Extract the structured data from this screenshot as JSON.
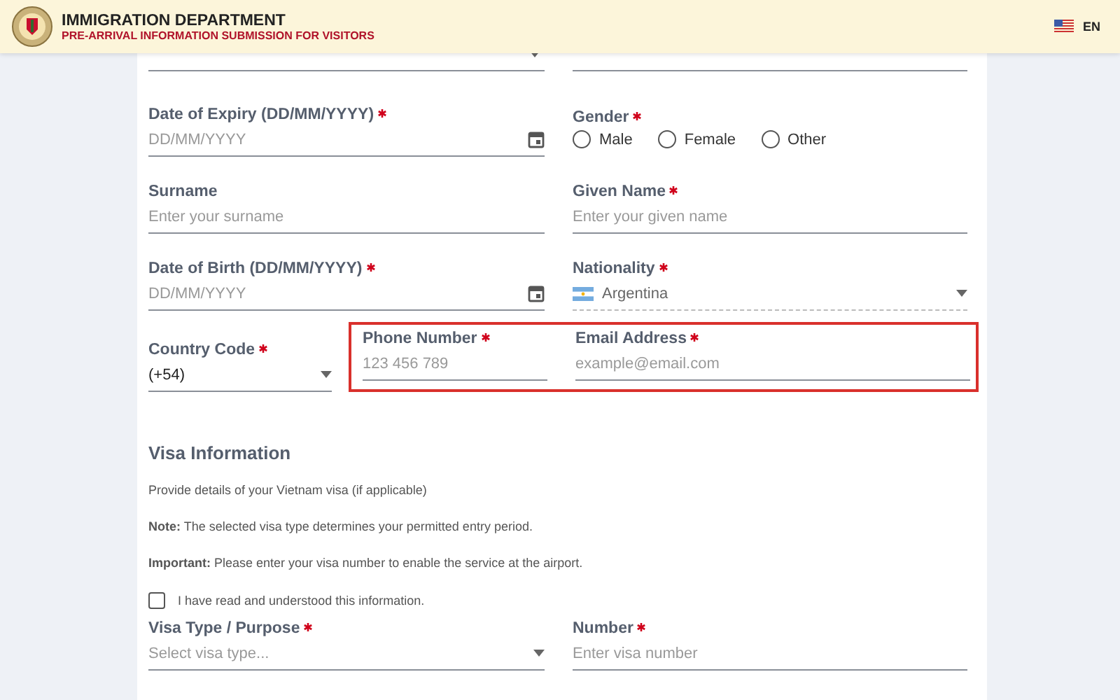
{
  "header": {
    "title": "IMMIGRATION DEPARTMENT",
    "subtitle": "PRE-ARRIVAL INFORMATION SUBMISSION FOR VISITORS",
    "language": "EN"
  },
  "rows": [
    [
      {
        "kind": "date",
        "label": "Date of Expiry (DD/MM/YYYY)",
        "required": true,
        "placeholder": "DD/MM/YYYY"
      },
      {
        "kind": "radio",
        "label": "Gender",
        "required": true,
        "options": [
          {
            "label": "Male",
            "selected": false
          },
          {
            "label": "Female",
            "selected": false
          },
          {
            "label": "Other",
            "selected": false
          }
        ]
      }
    ],
    [
      {
        "kind": "text",
        "label": "Surname",
        "required": false,
        "placeholder": "Enter your surname"
      },
      {
        "kind": "text",
        "label": "Given Name",
        "required": true,
        "placeholder": "Enter your given name"
      }
    ],
    [
      {
        "kind": "date",
        "label": "Date of Birth (DD/MM/YYYY)",
        "required": true,
        "placeholder": "DD/MM/YYYY"
      },
      {
        "kind": "country",
        "label": "Nationality",
        "required": true,
        "value": "Argentina"
      }
    ]
  ],
  "contact": {
    "country_code": {
      "label": "Country Code",
      "required": true,
      "value": "(+54)"
    },
    "highlighted": true,
    "phone": {
      "label": "Phone Number",
      "required": true,
      "placeholder": "123 456 789"
    },
    "email": {
      "label": "Email Address",
      "required": true,
      "placeholder": "example@email.com"
    }
  },
  "visa": {
    "title": "Visa Information",
    "paragraphs": [
      "Provide details of your Vietnam visa (if applicable)",
      "**Note:** The selected visa type determines your permitted entry period.",
      "**Important:** Please enter your visa number to enable the service at the airport."
    ],
    "acknowledge": {
      "label": "I have read and understood this information.",
      "checked": false
    },
    "fields": [
      {
        "kind": "select",
        "label": "Visa Type / Purpose",
        "required": true,
        "placeholder": "Select visa type..."
      },
      {
        "kind": "text",
        "label": "Number",
        "required": true,
        "placeholder": "Enter visa number"
      }
    ]
  }
}
